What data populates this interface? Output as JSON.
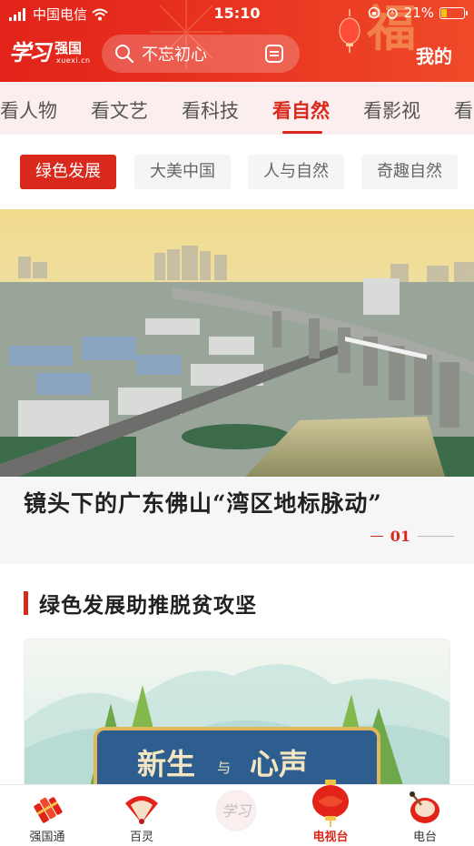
{
  "status_bar": {
    "carrier": "中国电信",
    "time": "15:10",
    "battery": "21%"
  },
  "header": {
    "logo_text": "学习",
    "logo_cn": "强国",
    "logo_en": "xuexi.cn",
    "search_placeholder": "不忘初心",
    "mine_label": "我的"
  },
  "tabs": [
    {
      "label": "看人物"
    },
    {
      "label": "看文艺"
    },
    {
      "label": "看科技"
    },
    {
      "label": "看自然",
      "active": true
    },
    {
      "label": "看影视"
    },
    {
      "label": "看"
    }
  ],
  "chips": [
    {
      "label": "绿色发展",
      "active": true
    },
    {
      "label": "大美中国"
    },
    {
      "label": "人与自然"
    },
    {
      "label": "奇趣自然"
    }
  ],
  "hero": {
    "title": "镜头下的广东佛山“湾区地标脉动”",
    "page_number": "01"
  },
  "section": {
    "title": "绿色发展助推脱贫攻坚",
    "card_title_a": "新生",
    "card_title_mid": "与",
    "card_title_b": "心声"
  },
  "bottom_nav": [
    {
      "label": "强国通"
    },
    {
      "label": "百灵"
    },
    {
      "label": "学习"
    },
    {
      "label": "电视台",
      "active": true
    },
    {
      "label": "电台"
    }
  ],
  "colors": {
    "accent": "#d9281c",
    "header": "#e2231a",
    "tab_bg": "#fbeeee"
  }
}
